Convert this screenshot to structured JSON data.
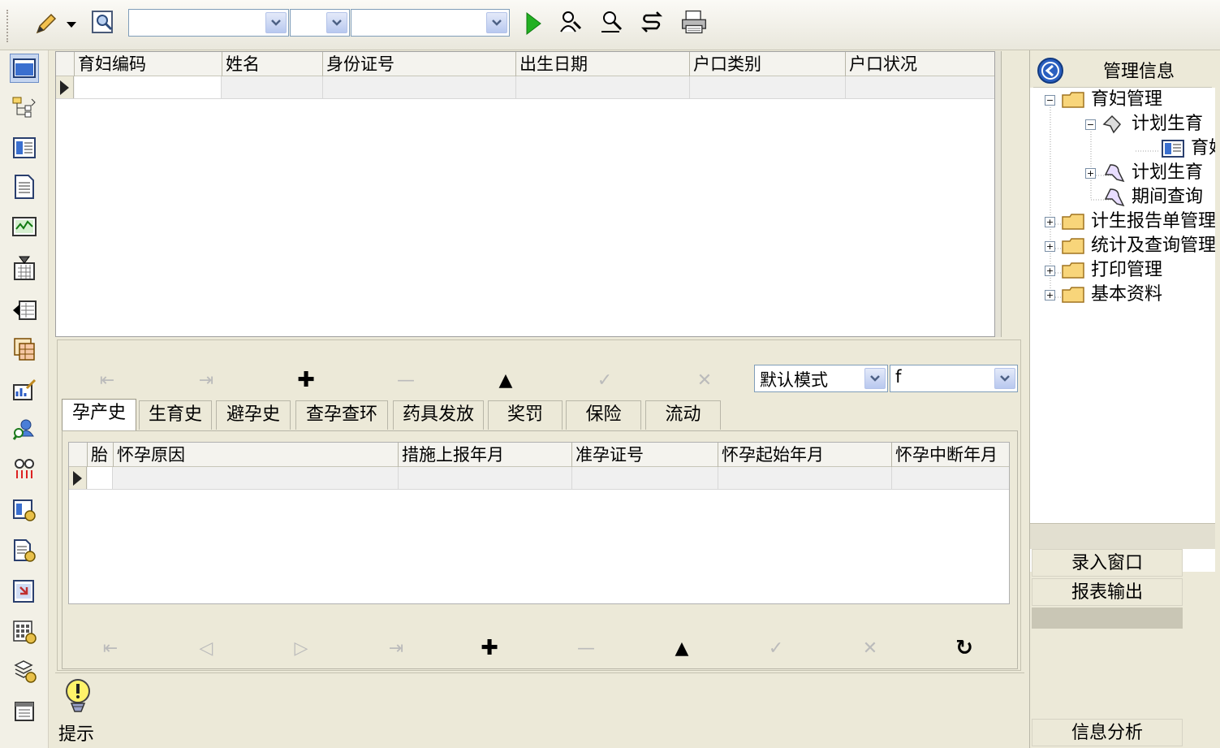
{
  "toolbar": {
    "combo1_value": "",
    "combo2_value": "",
    "combo3_value": ""
  },
  "grid_main": {
    "columns": [
      "育妇编码",
      "姓名",
      "身份证号",
      "出生日期",
      "户口类别",
      "户口状况"
    ]
  },
  "filter": {
    "mode_value": "默认模式",
    "value2": "f"
  },
  "tabs": [
    "孕产史",
    "生育史",
    "避孕史",
    "查孕查环",
    "药具发放",
    "奖罚",
    "保险",
    "流动"
  ],
  "grid_detail": {
    "columns": [
      "胎",
      "怀孕原因",
      "措施上报年月",
      "准孕证号",
      "怀孕起始年月",
      "怀孕中断年月"
    ]
  },
  "hint": {
    "label": "提示"
  },
  "right_panel": {
    "title": "管理信息",
    "tree": [
      {
        "label": "育妇管理",
        "level": 0,
        "toggle": "−",
        "icon": "folder-icon"
      },
      {
        "label": "计划生育",
        "level": 1,
        "toggle": "−",
        "icon": "ribbon-icon"
      },
      {
        "label": "育妇",
        "level": 2,
        "toggle": "",
        "icon": "form-icon"
      },
      {
        "label": "计划生育",
        "level": 1,
        "toggle": "+",
        "icon": "ribbon-icon"
      },
      {
        "label": "期间查询",
        "level": 1,
        "toggle": "",
        "icon": "ribbon-icon"
      },
      {
        "label": "计生报告单管理",
        "level": 0,
        "toggle": "+",
        "icon": "folder-icon"
      },
      {
        "label": "统计及查询管理",
        "level": 0,
        "toggle": "+",
        "icon": "folder-icon"
      },
      {
        "label": "打印管理",
        "level": 0,
        "toggle": "+",
        "icon": "folder-icon"
      },
      {
        "label": "基本资料",
        "level": 0,
        "toggle": "+",
        "icon": "folder-icon"
      }
    ],
    "buttons": {
      "entry": "录入窗口",
      "report": "报表输出",
      "analysis": "信息分析"
    }
  }
}
